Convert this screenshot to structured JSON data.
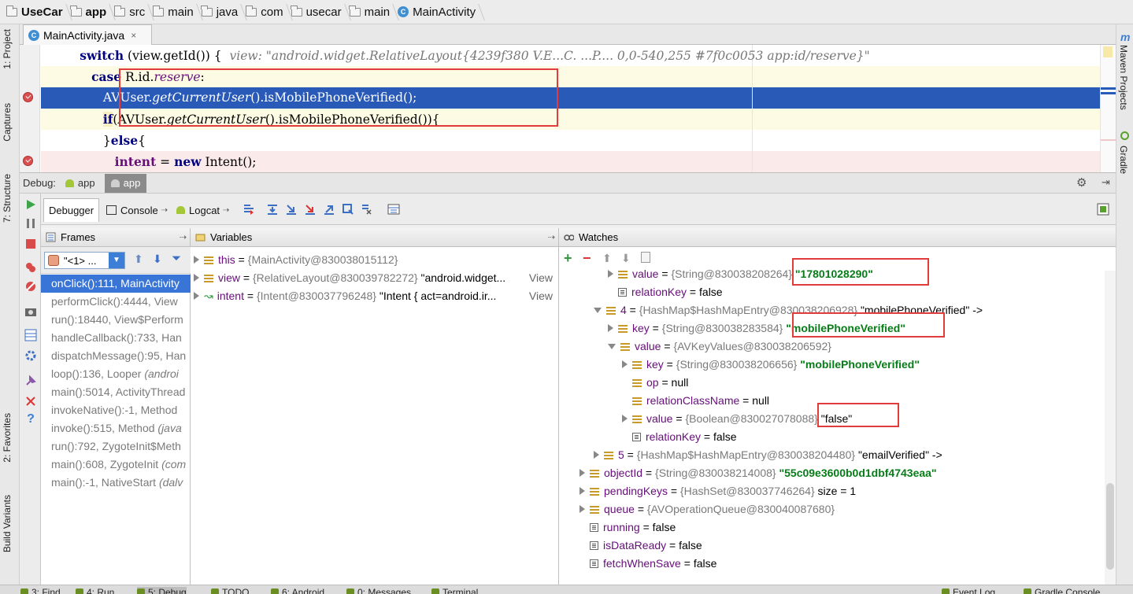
{
  "breadcrumb": [
    {
      "label": "UseCar",
      "icon": "folder-icon",
      "bold": true
    },
    {
      "label": "app",
      "icon": "folder-icon",
      "bold": true
    },
    {
      "label": "src",
      "icon": "folder-icon"
    },
    {
      "label": "main",
      "icon": "folder-icon"
    },
    {
      "label": "java",
      "icon": "folder-icon"
    },
    {
      "label": "com",
      "icon": "folder-icon"
    },
    {
      "label": "usecar",
      "icon": "folder-icon"
    },
    {
      "label": "main",
      "icon": "folder-icon"
    },
    {
      "label": "MainActivity",
      "icon": "class-icon"
    }
  ],
  "left_strip": {
    "project": "1: Project",
    "captures": "Captures",
    "structure": "7: Structure",
    "favorites": "2: Favorites",
    "build_variants": "Build Variants"
  },
  "right_strip": {
    "maven": "Maven Projects",
    "gradle": "Gradle"
  },
  "file_tab": {
    "label": "MainActivity.java",
    "close": "×"
  },
  "code": {
    "line1": {
      "keyword": "switch",
      "rest": " (view.getId()) {  ",
      "inline": "view: \"android.widget.RelativeLayout{4239f380 V.E...C. ...P.... 0,0-540,255 #7f0c0053 app:id/reserve}\""
    },
    "line2": {
      "keyword": "case",
      "rest1": " R.id.",
      "field": "reserve",
      "rest2": ":"
    },
    "line3": {
      "text1": "AVUser.",
      "method": "getCurrentUser",
      "text2": "().isMobilePhoneVerified();"
    },
    "line4": {
      "keyword": "if",
      "text1": "(AVUser.",
      "method": "getCurrentUser",
      "text2": "().isMobilePhoneVerified()){"
    },
    "line5": {
      "text1": "}",
      "keyword": "else",
      "text2": "{"
    },
    "line6": {
      "field": "intent",
      "text1": " = ",
      "keyword": "new",
      "text2": " Intent();"
    }
  },
  "debug_bar": {
    "label": "Debug:",
    "tab1": "app",
    "tab2": "app"
  },
  "toolbar": {
    "debugger": "Debugger",
    "console": "Console",
    "logcat": "Logcat"
  },
  "frames": {
    "title": "Frames",
    "thread": "\"<1> ...",
    "items": [
      {
        "main": "onClick():111, MainActivity",
        "italic": ""
      },
      {
        "main": "performClick():4444, View",
        "italic": ""
      },
      {
        "main": "run():18440, View$Perform",
        "italic": ""
      },
      {
        "main": "handleCallback():733, Han",
        "italic": ""
      },
      {
        "main": "dispatchMessage():95, Han",
        "italic": ""
      },
      {
        "main": "loop():136, Looper ",
        "italic": "(androi"
      },
      {
        "main": "main():5014, ActivityThread",
        "italic": ""
      },
      {
        "main": "invokeNative():-1, Method",
        "italic": ""
      },
      {
        "main": "invoke():515, Method ",
        "italic": "(java"
      },
      {
        "main": "run():792, ZygoteInit$Meth",
        "italic": ""
      },
      {
        "main": "main():608, ZygoteInit ",
        "italic": "(com"
      },
      {
        "main": "main():-1, NativeStart ",
        "italic": "(dalv"
      }
    ]
  },
  "variables": {
    "title": "Variables",
    "items": [
      {
        "name": "this",
        "ref": "{MainActivity@830038015112}",
        "value": "",
        "link": ""
      },
      {
        "name": "view",
        "ref": "{RelativeLayout@830039782272}",
        "value": "\"android.widget...",
        "link": "View"
      },
      {
        "name": "intent",
        "ref": "{Intent@830037796248}",
        "value": "\"Intent { act=android.ir...",
        "link": "View"
      }
    ]
  },
  "watches": {
    "title": "Watches",
    "rows": [
      {
        "name": "value",
        "ref": "{String@830038208264}",
        "value": "\"17801028290\"",
        "valueClass": "vs",
        "level": 2,
        "toggle": "right",
        "icon": "field"
      },
      {
        "name": "relationKey",
        "ref": "",
        "value": "false",
        "valueClass": "vv",
        "level": 2,
        "toggle": "none",
        "icon": "prim"
      },
      {
        "name": "4",
        "ref": "{HashMap$HashMapEntry@830038206928}",
        "value": "\"mobilePhoneVerified\" ->",
        "valueClass": "vv",
        "level": 1,
        "toggle": "down",
        "icon": "field"
      },
      {
        "name": "key",
        "ref": "{String@830038283584}",
        "value": "\"mobilePhoneVerified\"",
        "valueClass": "vs",
        "level": 2,
        "toggle": "right",
        "icon": "field"
      },
      {
        "name": "value",
        "ref": "{AVKeyValues@830038206592}",
        "value": "",
        "valueClass": "vv",
        "level": 2,
        "toggle": "down",
        "icon": "field"
      },
      {
        "name": "key",
        "ref": "{String@830038206656}",
        "value": "\"mobilePhoneVerified\"",
        "valueClass": "vs",
        "level": 3,
        "toggle": "right",
        "icon": "field"
      },
      {
        "name": "op",
        "ref": "",
        "value": "null",
        "valueClass": "vv",
        "level": 3,
        "toggle": "none",
        "icon": "field"
      },
      {
        "name": "relationClassName",
        "ref": "",
        "value": "null",
        "valueClass": "vv",
        "level": 3,
        "toggle": "none",
        "icon": "field"
      },
      {
        "name": "value",
        "ref": "{Boolean@830027078088}",
        "value": "\"false\"",
        "valueClass": "vv",
        "level": 3,
        "toggle": "right",
        "icon": "field"
      },
      {
        "name": "relationKey",
        "ref": "",
        "value": "false",
        "valueClass": "vv",
        "level": 3,
        "toggle": "none",
        "icon": "prim"
      },
      {
        "name": "5",
        "ref": "{HashMap$HashMapEntry@830038204480}",
        "value": "\"emailVerified\" ->",
        "valueClass": "vv",
        "level": 1,
        "toggle": "right",
        "icon": "field"
      },
      {
        "name": "objectId",
        "ref": "{String@830038214008}",
        "value": "\"55c09e3600b0d1dbf4743eaa\"",
        "valueClass": "vs",
        "level": 0,
        "toggle": "right",
        "icon": "field"
      },
      {
        "name": "pendingKeys",
        "ref": "{HashSet@830037746264}",
        "value": " size = 1",
        "valueClass": "vv",
        "level": 0,
        "toggle": "right",
        "icon": "field"
      },
      {
        "name": "queue",
        "ref": "{AVOperationQueue@830040087680}",
        "value": "",
        "valueClass": "vv",
        "level": 0,
        "toggle": "right",
        "icon": "field"
      },
      {
        "name": "running",
        "ref": "",
        "value": "false",
        "valueClass": "vv",
        "level": 0,
        "toggle": "none",
        "icon": "prim"
      },
      {
        "name": "isDataReady",
        "ref": "",
        "value": "false",
        "valueClass": "vv",
        "level": 0,
        "toggle": "none",
        "icon": "prim"
      },
      {
        "name": "fetchWhenSave",
        "ref": "",
        "value": "false",
        "valueClass": "vv",
        "level": 0,
        "toggle": "none",
        "icon": "prim"
      }
    ]
  },
  "bottom_tabs": [
    "3: Find",
    "4: Run",
    "5: Debug",
    "TODO",
    "6: Android",
    "0: Messages",
    "Terminal",
    "Event Log",
    "Gradle Console"
  ],
  "colors": {
    "accent": "#3875d7",
    "highlight_box": "#e23b3b",
    "string_value": "#067d17",
    "field_name": "#660e7a",
    "keyword": "#000080"
  }
}
